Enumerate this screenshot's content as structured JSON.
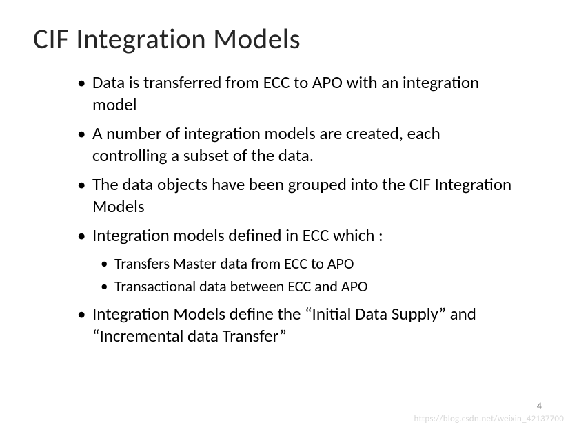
{
  "slide": {
    "title": "CIF Integration Models",
    "bullets": [
      {
        "text": "Data is transferred from ECC to APO with an integration model"
      },
      {
        "text": " A number of integration models  are created, each controlling  a subset of the data."
      },
      {
        "text": "The data objects have been grouped into the CIF Integration Models"
      },
      {
        "text": "Integration models defined in ECC which :",
        "sub": [
          "Transfers Master data from ECC to APO",
          "Transactional data between ECC and APO"
        ]
      },
      {
        "text": "Integration Models define the “Initial Data Supply” and “Incremental data Transfer”"
      }
    ],
    "page_number": "4",
    "watermark": "https://blog.csdn.net/weixin_42137700"
  }
}
